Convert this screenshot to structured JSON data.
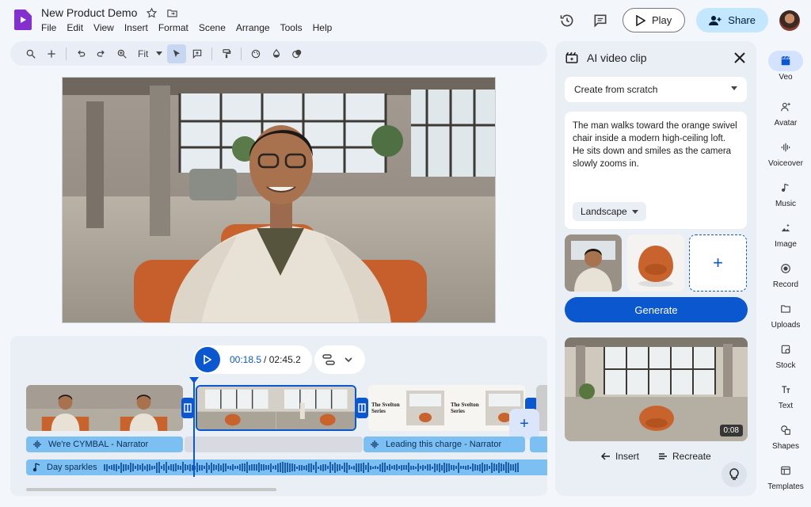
{
  "header": {
    "title": "New Product Demo",
    "menu": [
      "File",
      "Edit",
      "View",
      "Insert",
      "Format",
      "Scene",
      "Arrange",
      "Tools",
      "Help"
    ],
    "play_label": "Play",
    "share_label": "Share"
  },
  "toolbar": {
    "zoom_value": "Fit"
  },
  "timeline": {
    "current_time": "00:18.5",
    "total_time": "/ 02:45.2",
    "audio_tracks": [
      {
        "label": "We're CYMBAL - Narrator"
      },
      {
        "label": "Leading this charge - Narrator"
      },
      {
        "label": "Day sparkles"
      }
    ],
    "slide_text": "The Svelton Series"
  },
  "ai_panel": {
    "title": "AI video clip",
    "mode": "Create from scratch",
    "prompt": "The man walks toward the orange swivel chair inside a modern high-ceiling loft. He sits down and smiles as the camera slowly zooms in.",
    "aspect": "Landscape",
    "generate_label": "Generate",
    "result_duration": "0:08",
    "insert_label": "Insert",
    "recreate_label": "Recreate"
  },
  "rail": {
    "items": [
      {
        "label": "Veo",
        "icon": "veo-icon"
      },
      {
        "label": "Avatar",
        "icon": "avatar-icon"
      },
      {
        "label": "Voiceover",
        "icon": "voiceover-icon"
      },
      {
        "label": "Music",
        "icon": "music-icon"
      },
      {
        "label": "Image",
        "icon": "image-icon"
      },
      {
        "label": "Record",
        "icon": "record-icon"
      },
      {
        "label": "Uploads",
        "icon": "folder-icon"
      },
      {
        "label": "Stock",
        "icon": "stock-icon"
      },
      {
        "label": "Text",
        "icon": "text-icon"
      },
      {
        "label": "Shapes",
        "icon": "shapes-icon"
      },
      {
        "label": "Templates",
        "icon": "templates-icon"
      }
    ]
  },
  "colors": {
    "accent": "#0b57d0",
    "share_bg": "#c2e7ff",
    "audio_track": "#7cc0f3",
    "panel_bg": "#eaeef5"
  }
}
